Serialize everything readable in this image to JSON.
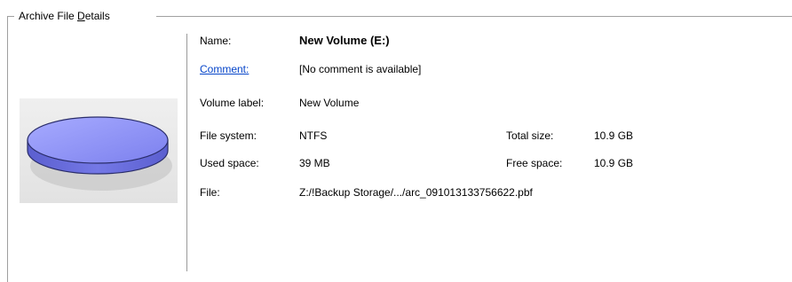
{
  "group": {
    "title_before": "Archive File ",
    "title_accel": "D",
    "title_after": "etails"
  },
  "icons": {
    "disk": "disk-volume-icon"
  },
  "colors": {
    "disk_fill": "#8a8ef0",
    "disk_edge": "#2a2d6a",
    "link": "#0645c9"
  },
  "details": {
    "name_label": "Name:",
    "name_value": "New Volume (E:)",
    "comment_label": "Comment:",
    "comment_value": "[No comment is available]",
    "volume_label_label": "Volume label:",
    "volume_label_value": "New Volume",
    "file_system_label": "File system:",
    "file_system_value": "NTFS",
    "total_size_label": "Total size:",
    "total_size_value": "10.9 GB",
    "used_space_label": "Used space:",
    "used_space_value": "39 MB",
    "free_space_label": "Free space:",
    "free_space_value": "10.9 GB",
    "file_label": "File:",
    "file_value": "Z:/!Backup Storage/.../arc_091013133756622.pbf"
  }
}
